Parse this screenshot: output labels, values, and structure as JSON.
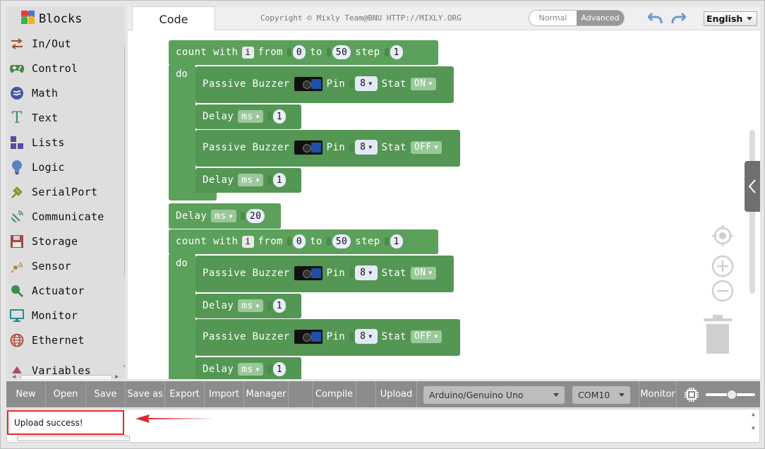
{
  "sidebar": {
    "title": "Blocks",
    "categories": [
      {
        "label": "In/Out",
        "icon": "arrows-icon"
      },
      {
        "label": "Control",
        "icon": "gamepad-icon"
      },
      {
        "label": "Math",
        "icon": "math-icon"
      },
      {
        "label": "Text",
        "icon": "text-t-icon"
      },
      {
        "label": "Lists",
        "icon": "lists-blocks-icon"
      },
      {
        "label": "Logic",
        "icon": "bulb-icon"
      },
      {
        "label": "SerialPort",
        "icon": "usb-plug-icon"
      },
      {
        "label": "Communicate",
        "icon": "satellite-icon"
      },
      {
        "label": "Storage",
        "icon": "floppy-icon"
      },
      {
        "label": "Sensor",
        "icon": "sensor-icon"
      },
      {
        "label": "Actuator",
        "icon": "actuator-icon"
      },
      {
        "label": "Monitor",
        "icon": "monitor-icon"
      },
      {
        "label": "Ethernet",
        "icon": "globe-icon"
      },
      {
        "label": "Variables",
        "icon": "variables-icon"
      }
    ]
  },
  "header": {
    "tab_code": "Code",
    "copyright": "Copyright © Mixly Team@BNU HTTP://MIXLY.ORG",
    "mode_normal": "Normal",
    "mode_advanced": "Advanced",
    "active_mode": "Advanced",
    "language": "English"
  },
  "blocks": {
    "loop1": {
      "count_with": "count with",
      "var": "i",
      "from": "from",
      "from_val": "0",
      "to": "to",
      "to_val": "50",
      "step": "step",
      "step_val": "1",
      "do": "do"
    },
    "loop2": {
      "count_with": "count with",
      "var": "i",
      "from": "from",
      "from_val": "0",
      "to": "to",
      "to_val": "50",
      "step": "step",
      "step_val": "1",
      "do": "do"
    },
    "buzzer_label": "Passive Buzzer",
    "pin_label": "Pin",
    "stat_label": "Stat",
    "pin_val": "8",
    "stat_on": "ON",
    "stat_off": "OFF",
    "delay_label": "Delay",
    "delay_unit": "ms",
    "inner_delay_val": "1",
    "outer_delay_val": "20"
  },
  "toolbar": {
    "new": "New",
    "open": "Open",
    "save": "Save",
    "save_as": "Save as",
    "export": "Export",
    "import": "Import",
    "manager": "Manager",
    "compile": "Compile",
    "upload": "Upload",
    "board": "Arduino/Genuino Uno",
    "port": "COM10",
    "monitor": "Monitor"
  },
  "console": {
    "status": "Upload success!"
  },
  "colors": {
    "block_green": "#5ba05b",
    "toolbar_gray": "#8c8c8c",
    "highlight_red": "#e02828"
  }
}
